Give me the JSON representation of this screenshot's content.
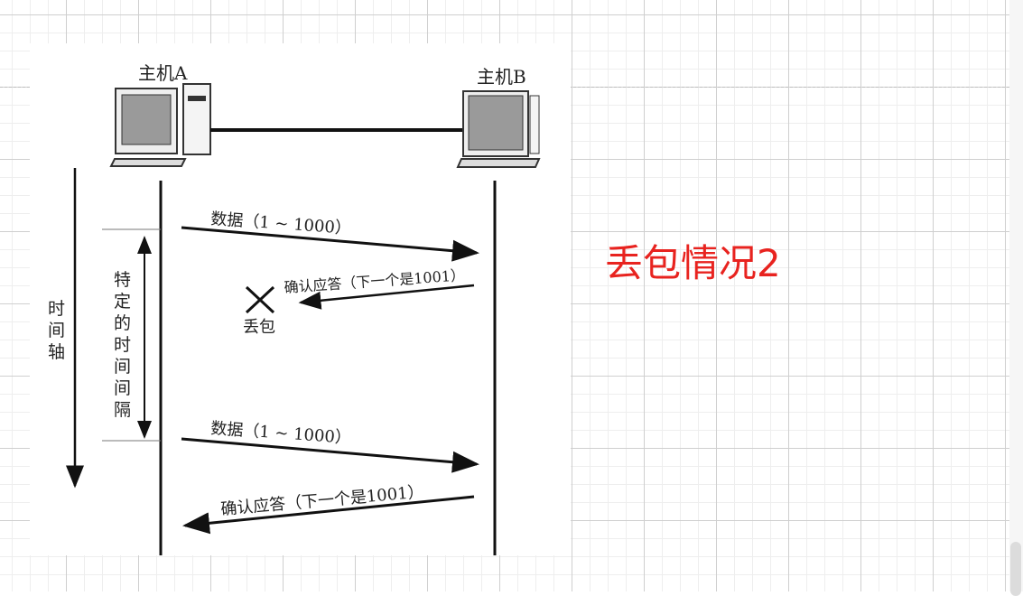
{
  "canvas": {
    "title_note": "丢包情况2",
    "note_color": "#e8231f"
  },
  "diagram": {
    "host_a": "主机A",
    "host_b": "主机B",
    "time_axis": [
      "时",
      "间",
      "轴"
    ],
    "interval": [
      "特",
      "定",
      "的",
      "时",
      "间",
      "间",
      "隔"
    ],
    "data1": "数据（1 ~ 1000）",
    "ack1": "确认应答（下一个是1001）",
    "lost": "丢包",
    "data2": "数据（1 ~ 1000）",
    "ack2": "确认应答（下一个是1001）"
  }
}
